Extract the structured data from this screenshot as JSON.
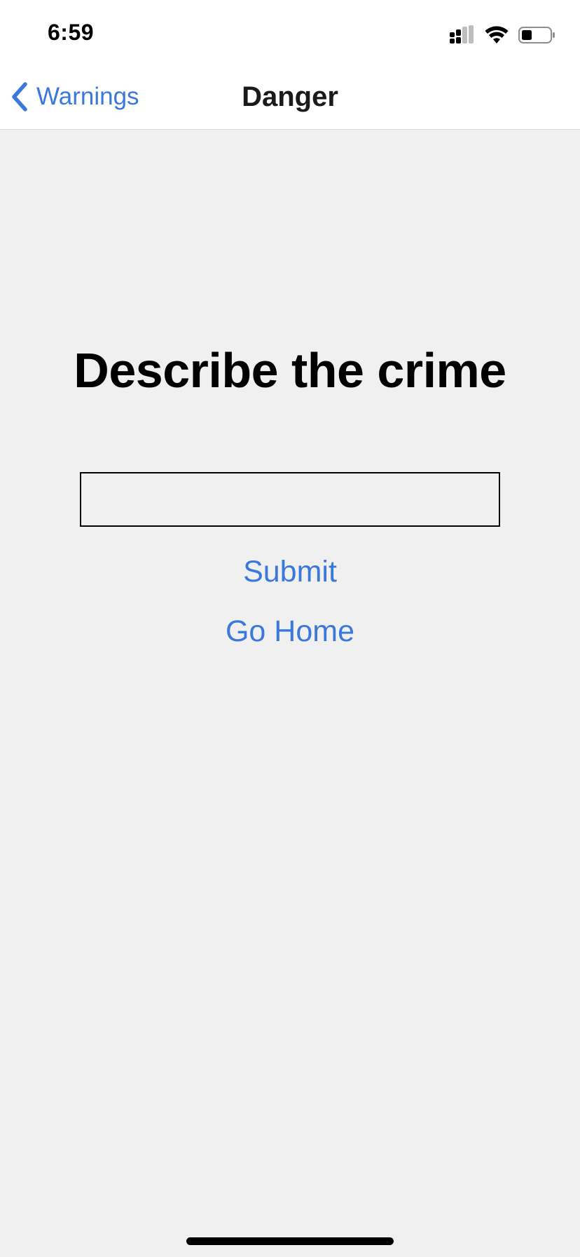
{
  "status_bar": {
    "time": "6:59",
    "icons": [
      "cellular-signal-icon",
      "wifi-icon",
      "battery-icon"
    ]
  },
  "nav": {
    "back_label": "Warnings",
    "back_icon": "chevron-left-icon",
    "title": "Danger"
  },
  "main": {
    "heading": "Describe the crime",
    "input_value": "",
    "input_placeholder": "",
    "submit_label": "Submit",
    "home_label": "Go Home"
  },
  "colors": {
    "accent": "#3a78db",
    "background": "#f0f0f0",
    "bar_background": "#ffffff"
  }
}
